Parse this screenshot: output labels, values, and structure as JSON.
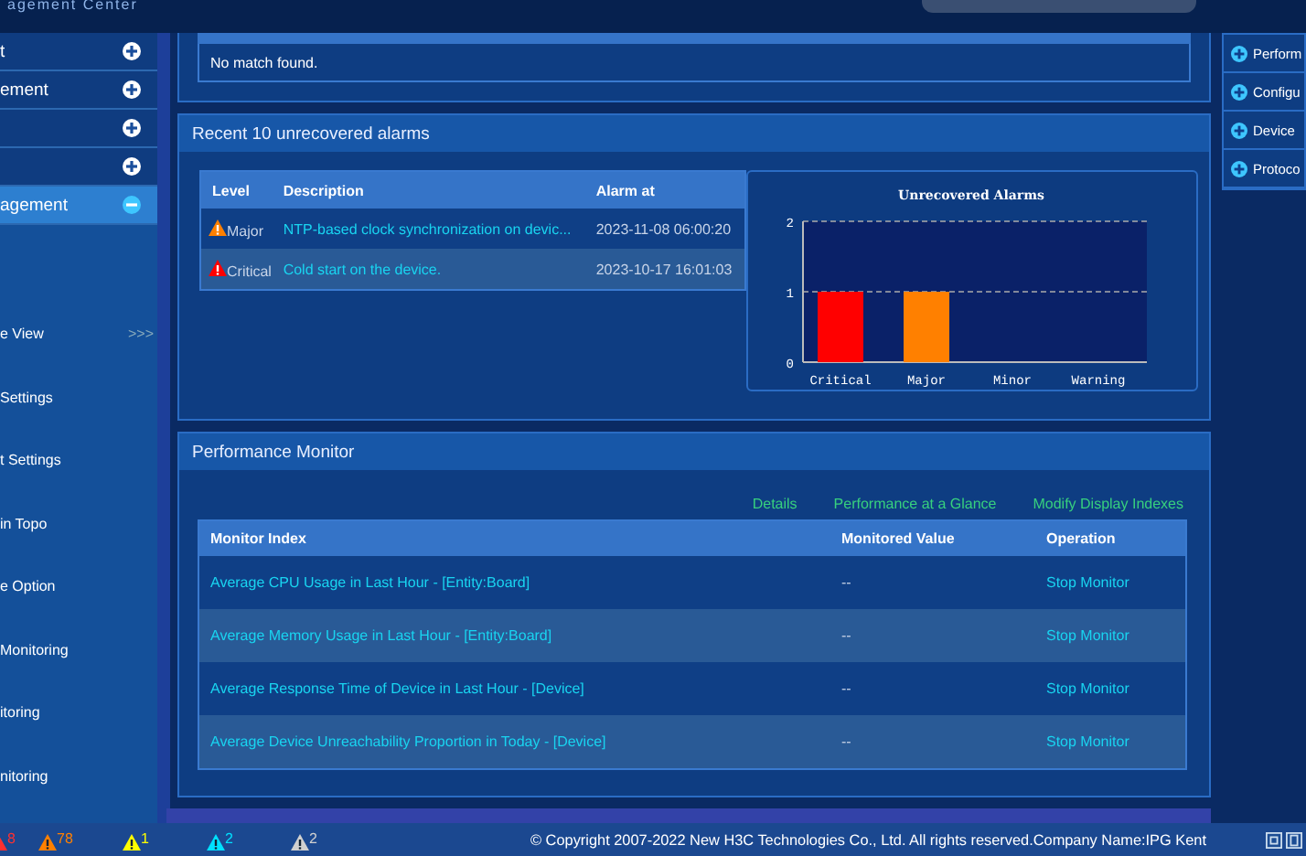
{
  "header": {
    "title": "agement Center"
  },
  "sidebar": {
    "sections": [
      {
        "label": "t",
        "expanded": false,
        "selected": false
      },
      {
        "label": "ement",
        "expanded": false,
        "selected": false
      },
      {
        "expanded": false,
        "selected": false
      },
      {
        "expanded": false,
        "selected": false
      },
      {
        "label": "agement",
        "expanded": true,
        "selected": true
      }
    ],
    "items": [
      {
        "label": "e View",
        "more": ">>>"
      },
      {
        "label": "Settings"
      },
      {
        "label": "t Settings"
      },
      {
        "label": "in Topo"
      },
      {
        "label": "e Option"
      },
      {
        "label": "Monitoring"
      },
      {
        "label": "itoring"
      },
      {
        "label": "nitoring"
      }
    ]
  },
  "search_panel": {
    "message": "No match found."
  },
  "alarms": {
    "title": "Recent 10 unrecovered alarms",
    "columns": [
      "Level",
      "Description",
      "Alarm at"
    ],
    "rows": [
      {
        "level": "Major",
        "color": "#ff8000",
        "description": "NTP-based clock synchronization on devic...",
        "time": "2023-11-08 06:00:20"
      },
      {
        "level": "Critical",
        "color": "#ff0000",
        "description": "Cold start on the device.",
        "time": "2023-10-17 16:01:03"
      }
    ],
    "chart_data": {
      "type": "bar",
      "title": "Unrecovered Alarms",
      "categories": [
        "Critical",
        "Major",
        "Minor",
        "Warning"
      ],
      "series": [
        {
          "color": "#ff0000",
          "values": [
            1,
            null,
            0,
            0
          ]
        },
        {
          "color": "#ff8000",
          "values": [
            null,
            1,
            null,
            null
          ]
        }
      ],
      "ylim": [
        0,
        2
      ],
      "yticks": [
        0,
        1,
        2
      ]
    }
  },
  "performance": {
    "title": "Performance Monitor",
    "links": [
      "Details",
      "Performance at a Glance",
      "Modify Display Indexes"
    ],
    "columns": [
      "Monitor Index",
      "Monitored Value",
      "Operation"
    ],
    "rows": [
      {
        "index": "Average CPU Usage in Last Hour - [Entity:Board]",
        "value": "--",
        "operation": "Stop Monitor"
      },
      {
        "index": "Average Memory Usage in Last Hour - [Entity:Board]",
        "value": "--",
        "operation": "Stop Monitor"
      },
      {
        "index": "Average Response Time of Device in Last Hour - [Device]",
        "value": "--",
        "operation": "Stop Monitor"
      },
      {
        "index": "Average Device Unreachability Proportion in Today - [Device]",
        "value": "--",
        "operation": "Stop Monitor"
      }
    ]
  },
  "right_panel": {
    "items": [
      "Perform",
      "Configu",
      "Device",
      "Protoco"
    ]
  },
  "status_bar": {
    "alarm_counts": [
      {
        "count": "8",
        "color": "#ff3030"
      },
      {
        "count": "78",
        "color": "#ff8000"
      },
      {
        "count": "1",
        "color": "#ffff00"
      },
      {
        "count": "2",
        "color": "#00e0ff"
      },
      {
        "count": "2",
        "color": "#d0d0d0"
      }
    ],
    "copyright": "© Copyright 2007-2022 New H3C Technologies Co., Ltd. All rights reserved.Company Name:IPG Kent"
  }
}
